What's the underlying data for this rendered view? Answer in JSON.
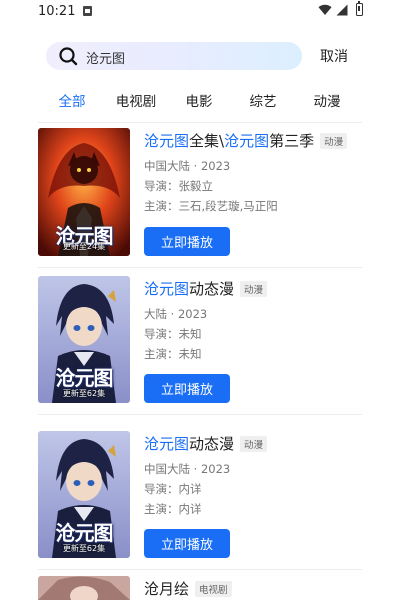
{
  "status_bar": {
    "time": "10:21"
  },
  "search": {
    "query": "沧元图",
    "cancel_label": "取消"
  },
  "tabs": [
    {
      "label": "全部",
      "active": true
    },
    {
      "label": "电视剧",
      "active": false
    },
    {
      "label": "电影",
      "active": false
    },
    {
      "label": "综艺",
      "active": false
    },
    {
      "label": "动漫",
      "active": false
    }
  ],
  "colors": {
    "accent": "#1a6ef5",
    "badge_bg": "#efefef"
  },
  "results": [
    {
      "title_parts": [
        {
          "text": "沧元图",
          "highlight": true
        },
        {
          "text": "全集\\",
          "highlight": false
        },
        {
          "text": "沧元图",
          "highlight": true
        },
        {
          "text": "第三季",
          "highlight": false
        }
      ],
      "type": "动漫",
      "region_year": "中国大陆 · 2023",
      "director": "导演：张毅立",
      "cast": "主演：三石,段艺璇,马正阳",
      "play_label": "立即播放",
      "poster_title": "沧元图",
      "poster_caption": "更新至24集"
    },
    {
      "title_parts": [
        {
          "text": "沧元图",
          "highlight": true
        },
        {
          "text": "动态漫",
          "highlight": false
        }
      ],
      "type": "动漫",
      "region_year": "大陆 · 2023",
      "director": "导演：未知",
      "cast": "主演：未知",
      "play_label": "立即播放",
      "poster_title": "沧元图",
      "poster_caption": "更新至62集"
    },
    {
      "title_parts": [
        {
          "text": "沧元图",
          "highlight": true
        },
        {
          "text": "动态漫",
          "highlight": false
        }
      ],
      "type": "动漫",
      "region_year": "中国大陆 · 2023",
      "director": "导演：内详",
      "cast": "主演：内详",
      "play_label": "立即播放",
      "poster_title": "沧元图",
      "poster_caption": "更新至62集"
    },
    {
      "title_parts": [
        {
          "text": "沧月绘",
          "highlight": false
        }
      ],
      "type": "电视剧"
    }
  ]
}
